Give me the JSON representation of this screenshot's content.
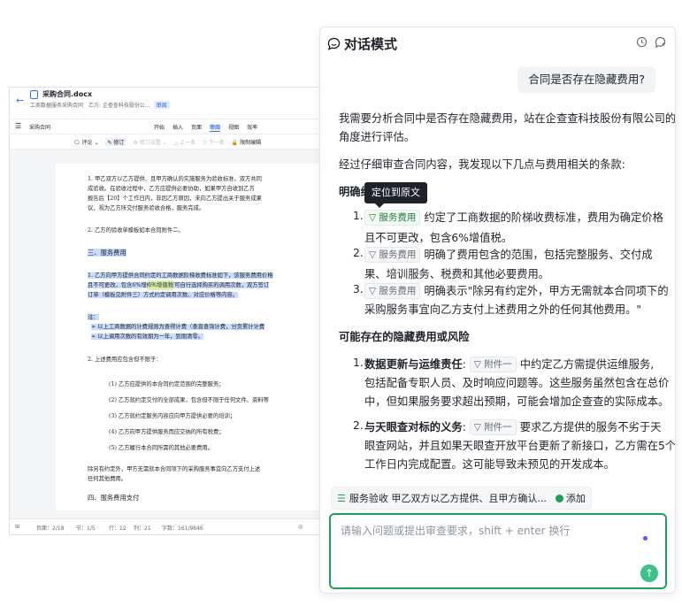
{
  "doc": {
    "back": "←",
    "filename": "采购合同.docx",
    "subtitle": "工商数据服务采购合同　乙方: 企查查科技股份公...",
    "tag": "审阅",
    "menubar": {
      "doc_label": "采购合同",
      "menus": [
        "开始",
        "插入",
        "页面",
        "审阅",
        "视图",
        "效率"
      ],
      "active": "审阅"
    },
    "toolbar": [
      "评论 ⌄",
      "修订",
      "修订设置 ⌄",
      "上一条",
      "下一条",
      "限制编辑"
    ],
    "lines": [
      "1.   甲乙双方以乙方提供、且甲方确认的实施服务为验收标准，双方共同",
      "      成验收。在验收过程中，乙方应提供必要协助，如果甲方自收到乙方",
      "      报告后【20】个工作日内，非因乙方原因，未向乙方提出关于服务成果",
      "      议，视为乙方所交付服务验收合格，服务完成。",
      "2.   乙方的验收单模板如本合同附件二。",
      "三、服务费用",
      "1.   乙方向甲方提供合同约定的工商数据阶梯收费标准如下，该服务费用价格",
      "      且不可更改，包含6%增值税，甲方可自行选择购买的调用次数，双方签订",
      "      订单（模板见附件三）方式约定调用次数、对应价格等内容。",
      "      注：",
      "➢   以上工商数据的计费规则为查得计费（查直查询计费，分页累计计费",
      "➢   以上调用次数的有效期为一年，到期清零。",
      "2.   上述费用应包含但不限于：",
      "(1)    乙方应提供的本合同约定范围的完整服务；",
      "(2)    乙方就约定交付的全部成果，包含但不限于任何文件、资料等",
      "(3)    乙方就约定服务内容应向甲方提供必要的培训；",
      "(4)    乙方向甲方提供服务而应交纳的所有税费；",
      "(5)    乙方履行本合同所需的其他必要费用。",
      "      除另有约定外，甲方无需就本合同项下的采购服务事宜向乙方支付上述",
      "任何其他费用。",
      "四、服务费用支付"
    ],
    "highlight_word": "6%增值税",
    "margin_letter": "T",
    "status": {
      "page": "页面：2/18",
      "section": "节：1/5",
      "row": "行：12",
      "col": "列：21",
      "words": "字数：161/9846"
    }
  },
  "chat": {
    "title": "对话模式",
    "user_question": "合同是否存在隐藏费用?",
    "intro_1": "我需要分析合同中是否存在隐藏费用，站在企查查科技股份有限公司的",
    "intro_2": "角度进行评估。",
    "intro_3": "经过仔细审查合同内容，我发现以下几点与费用相关的条款:",
    "section_1": "明确约",
    "tooltip": "定位到原文",
    "items": [
      {
        "num": "1.",
        "chip": "服务费用",
        "text": "约定了工商数据的阶梯收费标准，费用为确定价格",
        "text2": "且不可更改，包含6%增值税。"
      },
      {
        "num": "2.",
        "chip": "服务费用",
        "text": "明确了费用包含的范围，包括完整服务、交付成",
        "text2": "果、培训服务、税费和其他必要费用。"
      },
      {
        "num": "3.",
        "chip": "服务费用",
        "text": "明确表示\"除另有约定外，甲方无需就本合同项下的",
        "text2": "采购服务事宜向乙方支付上述费用之外的任何其他费用。\""
      }
    ],
    "section_2": "可能存在的隐藏费用或风险",
    "risks": [
      {
        "num": "1.",
        "title": "数据更新与运维责任",
        "colon": ":",
        "chip": "附件一",
        "text": "中约定乙方需提供运维服务,",
        "text2": "包括配备专职人员、及时响应问题等。这些服务虽然包含在总价",
        "text3": "中，但如果服务要求超出预期，可能会增加企查查的实际成本。"
      },
      {
        "num": "2.",
        "title": "与天眼查对标的义务",
        "colon": ":",
        "chip": "附件一",
        "text": "要求乙方提供的服务不劣于天",
        "text2": "眼查网站，并且如果天眼查开放平台更新了新接口，乙方需在5个",
        "text3": "工作日内完成配置。这可能导致未预见的开发成本。"
      }
    ],
    "reference": {
      "label": "服务验收 甲乙双方以乙方提供、且甲方确认...",
      "add": "添加"
    },
    "input_placeholder": "请输入问题或提出审查要求，shift + enter 换行"
  }
}
